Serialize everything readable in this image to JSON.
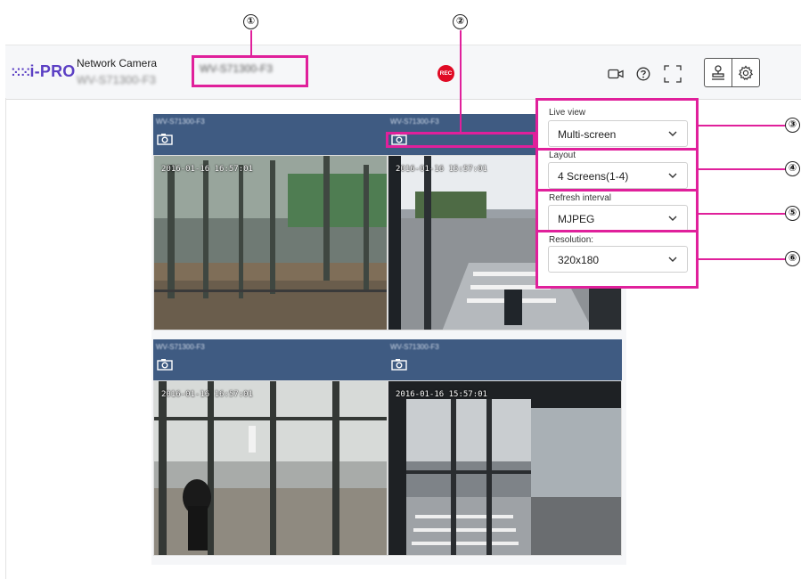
{
  "header": {
    "logo_dots": "⁙⁙",
    "logo_text": "i-PRO",
    "product_label": "Network Camera",
    "model_text": "WV-S71300-F3",
    "camera_title": "WV-S71300-F3",
    "rec_badge": "REC"
  },
  "toolbar": {
    "icons": [
      "video-camera-icon",
      "help-circle-icon",
      "fullscreen-icon",
      "user-maintenance-icon",
      "gear-icon"
    ]
  },
  "cameras": [
    {
      "name": "WV-S71300-F3",
      "timestamp": "2016-01-16 16:57:01"
    },
    {
      "name": "WV-S71300-F3",
      "timestamp": "2016-01-16 15:57:01"
    },
    {
      "name": "WV-S71300-F3",
      "timestamp": "2016-01-16 16:57:01"
    },
    {
      "name": "WV-S71300-F3",
      "timestamp": "2016-01-16 15:57:01"
    }
  ],
  "panel": {
    "live_view": {
      "label": "Live view",
      "value": "Multi-screen"
    },
    "layout": {
      "label": "Layout",
      "value": "4 Screens(1-4)"
    },
    "refresh_interval": {
      "label": "Refresh interval",
      "value": "MJPEG"
    },
    "resolution": {
      "label": "Resolution:",
      "value": "320x180"
    }
  },
  "callouts": [
    "①",
    "②",
    "③",
    "④",
    "⑤",
    "⑥"
  ],
  "colors": {
    "accent_magenta": "#e0209b",
    "header_bar": "#3f5b82",
    "brand_purple": "#5b3fc4",
    "rec_red": "#e00a24"
  }
}
